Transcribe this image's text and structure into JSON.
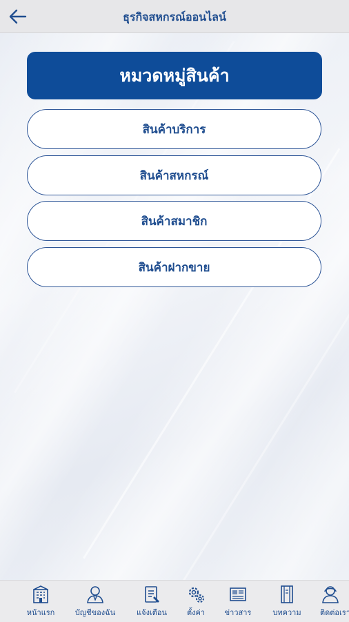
{
  "topbar": {
    "title": "ธุรกิจสหกรณ์ออนไลน์",
    "back_icon": "arrow-left-icon"
  },
  "category": {
    "heading": "หมวดหมู่สินค้า",
    "items": [
      {
        "label": "สินค้าบริการ"
      },
      {
        "label": "สินค้าสหกรณ์"
      },
      {
        "label": "สินค้าสมาชิก"
      },
      {
        "label": "สินค้าฝากขาย"
      }
    ]
  },
  "bottom_nav": {
    "items": [
      {
        "label": "หน้าแรก",
        "icon": "building-icon"
      },
      {
        "label": "บัญชีของฉัน",
        "icon": "user-account-icon"
      },
      {
        "label": "แจ้งเตือน",
        "icon": "notification-doc-icon"
      },
      {
        "label": "ตั้งค่า",
        "icon": "settings-gears-icon"
      },
      {
        "label": "ข่าวสาร",
        "icon": "newspaper-icon"
      },
      {
        "label": "บทความ",
        "icon": "article-book-icon"
      },
      {
        "label": "ติดต่อเรา",
        "icon": "contact-person-icon"
      }
    ]
  },
  "colors": {
    "primary": "#0e4c99",
    "text_blue": "#1f4d8f",
    "bar_bg": "#e7e7e9"
  }
}
